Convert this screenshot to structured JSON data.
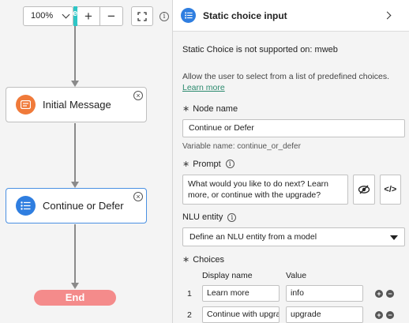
{
  "canvas": {
    "toolbar": {
      "zoom_value": "100%",
      "start_tab_label": "e",
      "zoom_in_label": "+",
      "zoom_out_label": "−"
    },
    "nodes": [
      {
        "label": "Initial Message",
        "icon": "message-icon",
        "color": "#f07a3a"
      },
      {
        "label": "Continue or Defer",
        "icon": "list-icon",
        "color": "#2f7ee0"
      }
    ],
    "end_label": "End"
  },
  "panel": {
    "title": "Static choice input",
    "warning": "Static Choice is not supported on: mweb",
    "description": "Allow the user to select from a list of predefined choices.",
    "learn_more": "Learn more",
    "node_name": {
      "label": "Node name",
      "value": "Continue or Defer",
      "variable_hint": "Variable name: continue_or_defer"
    },
    "prompt": {
      "label": "Prompt",
      "value": "What would you like to do next? Learn more, or continue with the upgrade?",
      "code_button": "</>"
    },
    "nlu": {
      "label": "NLU entity",
      "value": "Define an NLU entity from a model"
    },
    "choices": {
      "label": "Choices",
      "col_display": "Display name",
      "col_value": "Value",
      "rows": [
        {
          "num": "1",
          "display": "Learn more",
          "value": "info"
        },
        {
          "num": "2",
          "display": "Continue with upgra",
          "value": "upgrade"
        }
      ]
    }
  },
  "colors": {
    "accent": "#2f7ee0",
    "message_node": "#f07a3a",
    "end_node": "#f48b8b",
    "link": "#2b8a6e",
    "start_tab": "#2ec6c6"
  }
}
